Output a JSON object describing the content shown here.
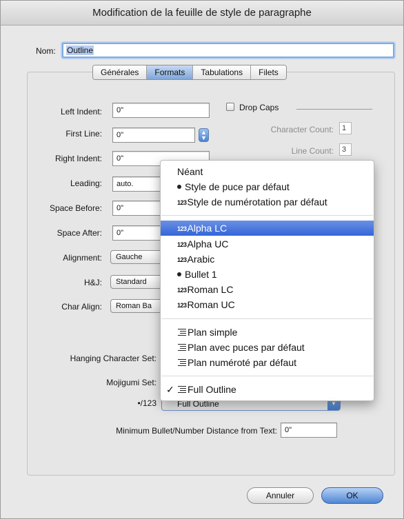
{
  "window": {
    "title": "Modification de la feuille de style de paragraphe"
  },
  "name": {
    "label": "Nom:",
    "value": "Outline"
  },
  "tabs": [
    {
      "label": "Générales",
      "active": false
    },
    {
      "label": "Formats",
      "active": true
    },
    {
      "label": "Tabulations",
      "active": false
    },
    {
      "label": "Filets",
      "active": false
    }
  ],
  "form": {
    "left_indent": {
      "label": "Left Indent:",
      "value": "0\""
    },
    "first_line": {
      "label": "First Line:",
      "value": "0\""
    },
    "right_indent": {
      "label": "Right Indent:",
      "value": "0\""
    },
    "leading": {
      "label": "Leading:",
      "value": "auto."
    },
    "space_before": {
      "label": "Space Before:",
      "value": "0\""
    },
    "space_after": {
      "label": "Space After:",
      "value": "0\""
    },
    "alignment": {
      "label": "Alignment:",
      "value": "Gauche"
    },
    "hj": {
      "label": "H&J:",
      "value": "Standard"
    },
    "char_align": {
      "label": "Char Align:",
      "value": "Roman Ba"
    },
    "hanging_set": {
      "label": "Hanging Character Set:"
    },
    "mojigumi_set": {
      "label": "Mojigumi Set:"
    },
    "bullet_numbering": {
      "label": "•/123",
      "value": "Full Outline"
    },
    "min_distance": {
      "label": "Minimum Bullet/Number Distance from Text:",
      "value": "0\""
    }
  },
  "drop_caps": {
    "label": "Drop Caps",
    "checked": false,
    "character_count": {
      "label": "Character Count:",
      "value": "1"
    },
    "line_count": {
      "label": "Line Count:",
      "value": "3"
    }
  },
  "menu": {
    "items": [
      {
        "label": "Néant",
        "icon": "none",
        "highlighted": false,
        "checked": false
      },
      {
        "label": "Style de puce par défaut",
        "icon": "bullet-icon",
        "highlighted": false,
        "checked": false
      },
      {
        "label": "Style de numérotation par défaut",
        "icon": "number-icon",
        "highlighted": false,
        "checked": false
      },
      {
        "label": "Alpha LC",
        "icon": "number-icon",
        "highlighted": true,
        "checked": false
      },
      {
        "label": "Alpha UC",
        "icon": "number-icon",
        "highlighted": false,
        "checked": false
      },
      {
        "label": "Arabic",
        "icon": "number-icon",
        "highlighted": false,
        "checked": false
      },
      {
        "label": "Bullet 1",
        "icon": "bullet-icon",
        "highlighted": false,
        "checked": false
      },
      {
        "label": "Roman LC",
        "icon": "number-icon",
        "highlighted": false,
        "checked": false
      },
      {
        "label": "Roman UC",
        "icon": "number-icon",
        "highlighted": false,
        "checked": false
      },
      {
        "label": "Plan simple",
        "icon": "outline-icon",
        "highlighted": false,
        "checked": false
      },
      {
        "label": "Plan avec puces par défaut",
        "icon": "outline-icon",
        "highlighted": false,
        "checked": false
      },
      {
        "label": "Plan numéroté par défaut",
        "icon": "outline-icon",
        "highlighted": false,
        "checked": false
      },
      {
        "label": "Full Outline",
        "icon": "outline-icon",
        "highlighted": false,
        "checked": true
      }
    ],
    "number_icon_text": "123",
    "check_mark": "✓"
  },
  "buttons": {
    "cancel": "Annuler",
    "ok": "OK"
  },
  "colors": {
    "highlight": "#3466d8",
    "default_button": "#4f86d4"
  }
}
